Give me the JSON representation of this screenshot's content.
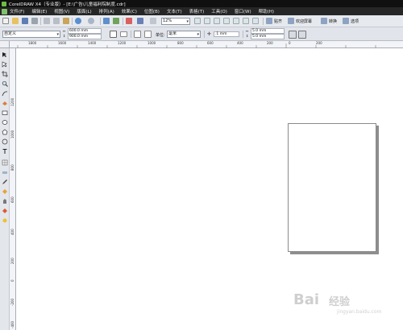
{
  "window": {
    "title": "CorelDRAW X4（专业版）- [E:\\广告\\儿童福利院制度.cdr]"
  },
  "menu": [
    "文件(F)",
    "编辑(E)",
    "视图(V)",
    "版面(L)",
    "排列(A)",
    "效果(C)",
    "位图(B)",
    "文本(T)",
    "表格(T)",
    "工具(O)",
    "窗口(W)",
    "帮助(H)"
  ],
  "standard_toolbar": {
    "zoom_value": "12%",
    "snap_label": "贴齐",
    "welcome_label": "欢迎屏幕",
    "convert_label": "转换",
    "options_label": "选项"
  },
  "property_bar": {
    "page_size": "自定义",
    "width": "600.0 mm",
    "height": "900.0 mm",
    "units_label": "单位:",
    "units_value": "毫米",
    "nudge": ".1 mm",
    "dup_x": "5.0 mm",
    "dup_y": "5.0 mm"
  },
  "ruler": {
    "h_labels": [
      "1800",
      "1600",
      "1400",
      "1200",
      "1000",
      "800",
      "600",
      "400",
      "200",
      "0",
      "200"
    ],
    "v_labels": [
      "1200",
      "1000",
      "800",
      "600",
      "400",
      "200",
      "0",
      "-200",
      "-400"
    ]
  },
  "watermark": {
    "brand": "Bai",
    "brand2": "经验",
    "url": "jingyan.baidu.com"
  },
  "colors": {
    "title_bg": "#101010",
    "menu_bg": "#262626",
    "toolbar_bg": "#e6e9ee",
    "page_shadow": "#8e8e8e"
  }
}
